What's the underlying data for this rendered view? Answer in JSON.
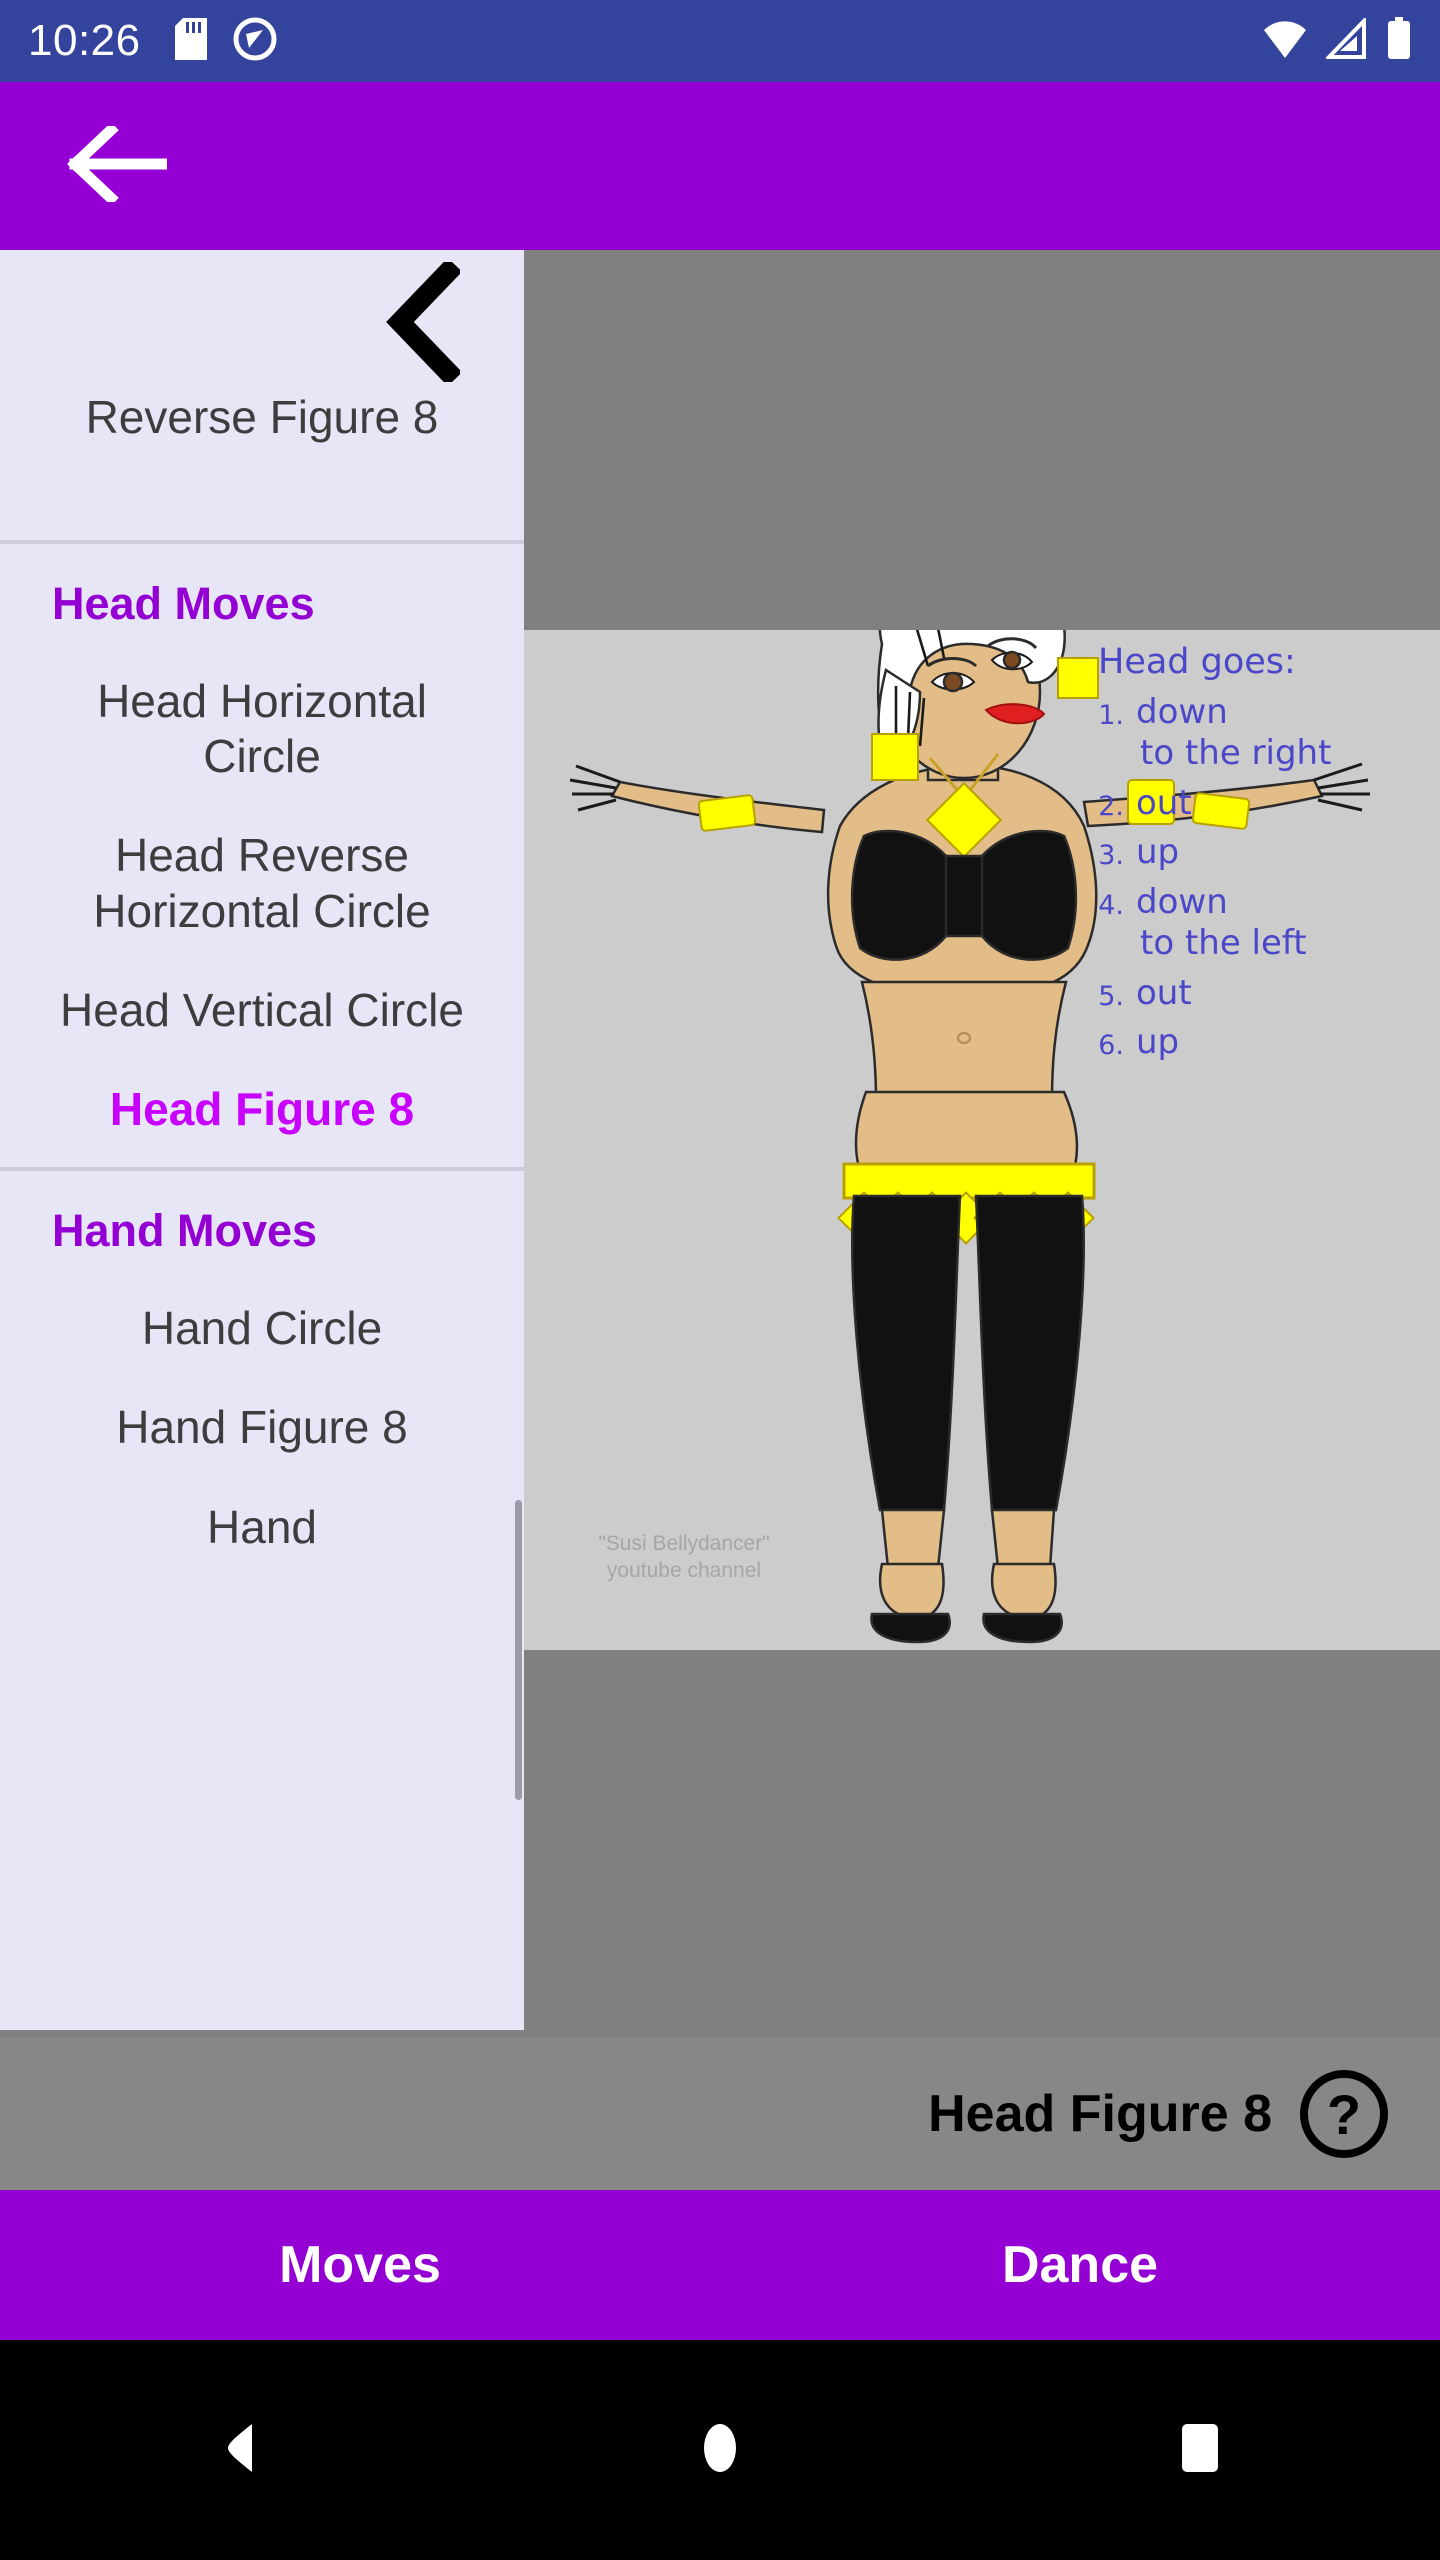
{
  "status_bar": {
    "time": "10:26",
    "left_icons": [
      "sd-card-icon",
      "location-off-icon"
    ],
    "right_icons": [
      "wifi-icon",
      "cellular-signal-icon",
      "battery-icon"
    ],
    "background_color": "#34449c"
  },
  "toolbar": {
    "back_label": "back-arrow-icon",
    "background_color": "#9400d3"
  },
  "sidebar": {
    "background_color": "#e6e6f7",
    "current_item": {
      "label": "Reverse Figure 8",
      "collapse_icon": "chevron-left-icon"
    },
    "sections": [
      {
        "header": "Head Moves",
        "items": [
          {
            "label": "Head Horizontal Circle",
            "selected": false
          },
          {
            "label": "Head Reverse Horizontal Circle",
            "selected": false
          },
          {
            "label": "Head Vertical Circle",
            "selected": false
          },
          {
            "label": "Head Figure 8",
            "selected": true
          }
        ]
      },
      {
        "header": "Hand Moves",
        "items": [
          {
            "label": "Hand Circle",
            "selected": false
          },
          {
            "label": "Hand Figure 8",
            "selected": false
          },
          {
            "label": "Hand",
            "selected": false
          }
        ]
      }
    ],
    "header_color": "#9400d3",
    "selected_color": "#c800ff",
    "item_color": "#3d3d3d"
  },
  "image_panel": {
    "background_color": "#cccccc",
    "illustration_name": "bellydancer-figure",
    "watermark_line1": "\"Susi Bellydancer\"",
    "watermark_line2": "youtube channel",
    "instructions": {
      "title": "Head goes:",
      "steps": [
        {
          "num": "1.",
          "text": "down",
          "continuation": "to the right"
        },
        {
          "num": "2.",
          "text": "out",
          "continuation": ""
        },
        {
          "num": "3.",
          "text": "up",
          "continuation": ""
        },
        {
          "num": "4.",
          "text": "down",
          "continuation": "to the left"
        },
        {
          "num": "5.",
          "text": "out",
          "continuation": ""
        },
        {
          "num": "6.",
          "text": "up",
          "continuation": ""
        }
      ],
      "ink_color": "#4a47c8"
    }
  },
  "move_label_bar": {
    "move_name": "Head Figure 8",
    "help_icon": "question-mark-circle-icon",
    "background_color": "#878787"
  },
  "bottom_tabs": {
    "background_color": "#9400d3",
    "tabs": [
      {
        "label": "Moves",
        "active": true
      },
      {
        "label": "Dance",
        "active": false
      }
    ]
  },
  "nav_bar": {
    "background_color": "#000000",
    "buttons": [
      "back-triangle-icon",
      "home-circle-icon",
      "recents-square-icon"
    ]
  }
}
